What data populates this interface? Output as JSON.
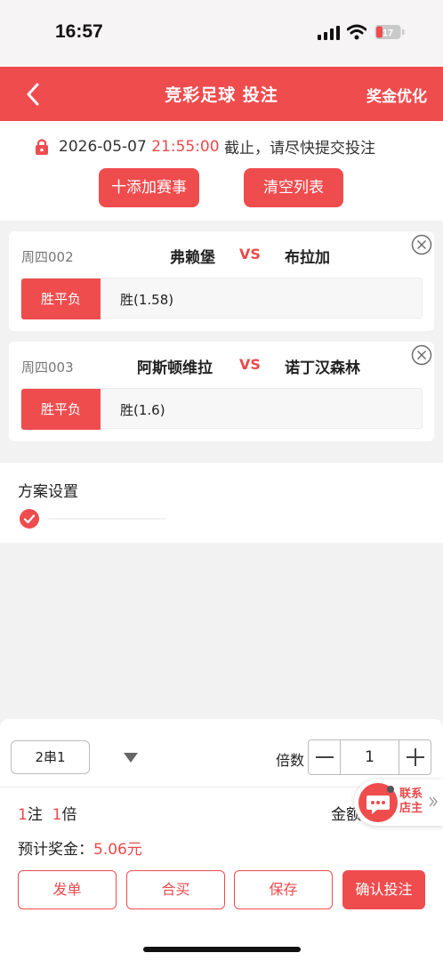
{
  "status_bar": {
    "time": "16:57",
    "battery": "17"
  },
  "header": {
    "title": "竞彩足球 投注",
    "action": "奖金优化"
  },
  "deadline": {
    "date": "2026-05-07",
    "time": "21:55:00",
    "suffix": "截止，请尽快提交投注"
  },
  "buttons": {
    "add_match": "十添加赛事",
    "clear_list": "清空列表"
  },
  "matches": [
    {
      "id": "周四002",
      "home": "弗赖堡",
      "vs": "VS",
      "away": "布拉加",
      "bet_type": "胜平负",
      "selection": "胜(1.58)"
    },
    {
      "id": "周四003",
      "home": "阿斯顿维拉",
      "vs": "VS",
      "away": "诺丁汉森林",
      "bet_type": "胜平负",
      "selection": "胜(1.6)"
    }
  ],
  "plan": {
    "title": "方案设置"
  },
  "bottom": {
    "combo": "2串1",
    "multiplier_label": "倍数",
    "multiplier_value": "1",
    "bets_count": "1",
    "bets_unit": "注",
    "multiple": "1",
    "multiple_unit": "倍",
    "amount_label": "金额",
    "prize_label": "预计奖金：",
    "prize_value": "5.06元",
    "contact": "联系店主",
    "actions": [
      "发单",
      "合买",
      "保存",
      "确认投注"
    ]
  },
  "colors": {
    "accent": "#ef4c4e",
    "text_red": "#e9494b"
  }
}
